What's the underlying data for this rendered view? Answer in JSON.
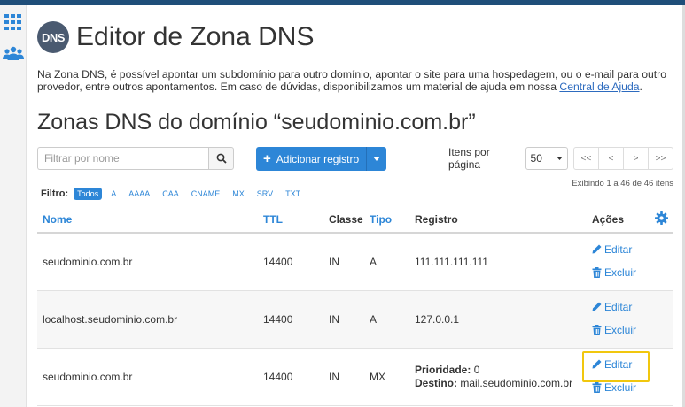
{
  "header": {
    "logo_text": "DNS",
    "title": "Editor de Zona DNS"
  },
  "intro": {
    "text": "Na Zona DNS, é possível apontar um subdomínio para outro domínio, apontar o site para uma hospedagem, ou o e-mail para outro provedor, entre outros apontamentos. Em caso de dúvidas, disponibilizamos um material de ajuda em nossa ",
    "link_text": "Central de Ajuda",
    "suffix": "."
  },
  "section_title": "Zonas DNS do domínio “seudominio.com.br”",
  "toolbar": {
    "filter_placeholder": "Filtrar por nome",
    "add_label": "Adicionar registro",
    "per_page_label": "Itens por página",
    "per_page_value": "50",
    "pager": [
      "<<",
      "<",
      ">",
      ">>"
    ],
    "showing": "Exibindo 1 a 46 de 46 itens"
  },
  "filters": {
    "label": "Filtro:",
    "chips": [
      "Todos",
      "A",
      "AAAA",
      "CAA",
      "CNAME",
      "MX",
      "SRV",
      "TXT"
    ],
    "active": "Todos"
  },
  "table": {
    "headers": {
      "name": "Nome",
      "ttl": "TTL",
      "class": "Classe",
      "type": "Tipo",
      "record": "Registro",
      "actions": "Ações"
    },
    "edit_label": "Editar",
    "delete_label": "Excluir",
    "rows": [
      {
        "name": "seudominio.com.br",
        "ttl": "14400",
        "class": "IN",
        "type": "A",
        "record": "111.111.111.111"
      },
      {
        "name": "localhost.seudominio.com.br",
        "ttl": "14400",
        "class": "IN",
        "type": "A",
        "record": "127.0.0.1"
      },
      {
        "name": "seudominio.com.br",
        "ttl": "14400",
        "class": "IN",
        "type": "MX",
        "priority_label": "Prioridade:",
        "priority": "0",
        "dest_label": "Destino:",
        "dest": "mail.seudominio.com.br"
      }
    ]
  },
  "colors": {
    "accent": "#2d86d7",
    "highlight": "#f1c70e",
    "topbar": "#1f4e79"
  },
  "icons": [
    "apps-grid-icon",
    "users-icon",
    "search-icon",
    "plus-icon",
    "caret-down-icon",
    "gear-icon",
    "pencil-icon",
    "trash-icon"
  ]
}
